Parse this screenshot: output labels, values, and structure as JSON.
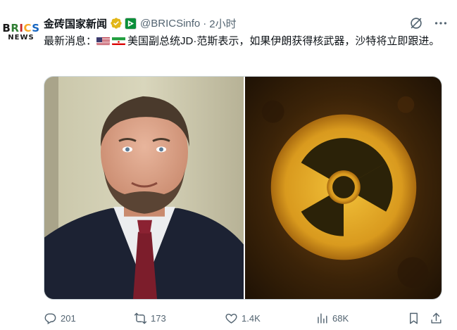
{
  "author": {
    "avatar_top": "BRICS",
    "avatar_bottom": "NEWS",
    "name": "金砖国家新闻",
    "handle": "@BRICSinfo",
    "separator": "·",
    "time": "2小时"
  },
  "post": {
    "prefix": "最新消息：",
    "flags": [
      "us-flag",
      "iran-flag"
    ],
    "body": "美国副总统JD·范斯表示，如果伊朗获得核武器，沙特将立即跟进。"
  },
  "media": [
    {
      "icon": "photo-portrait"
    },
    {
      "icon": "radiation-symbol"
    }
  ],
  "actions": {
    "replies": "201",
    "reposts": "173",
    "likes": "1.4K",
    "views": "68K"
  },
  "colors": {
    "text": "#0f1419",
    "secondary": "#536471",
    "verified_gold": "#e2b719",
    "border": "#cfd9de"
  }
}
